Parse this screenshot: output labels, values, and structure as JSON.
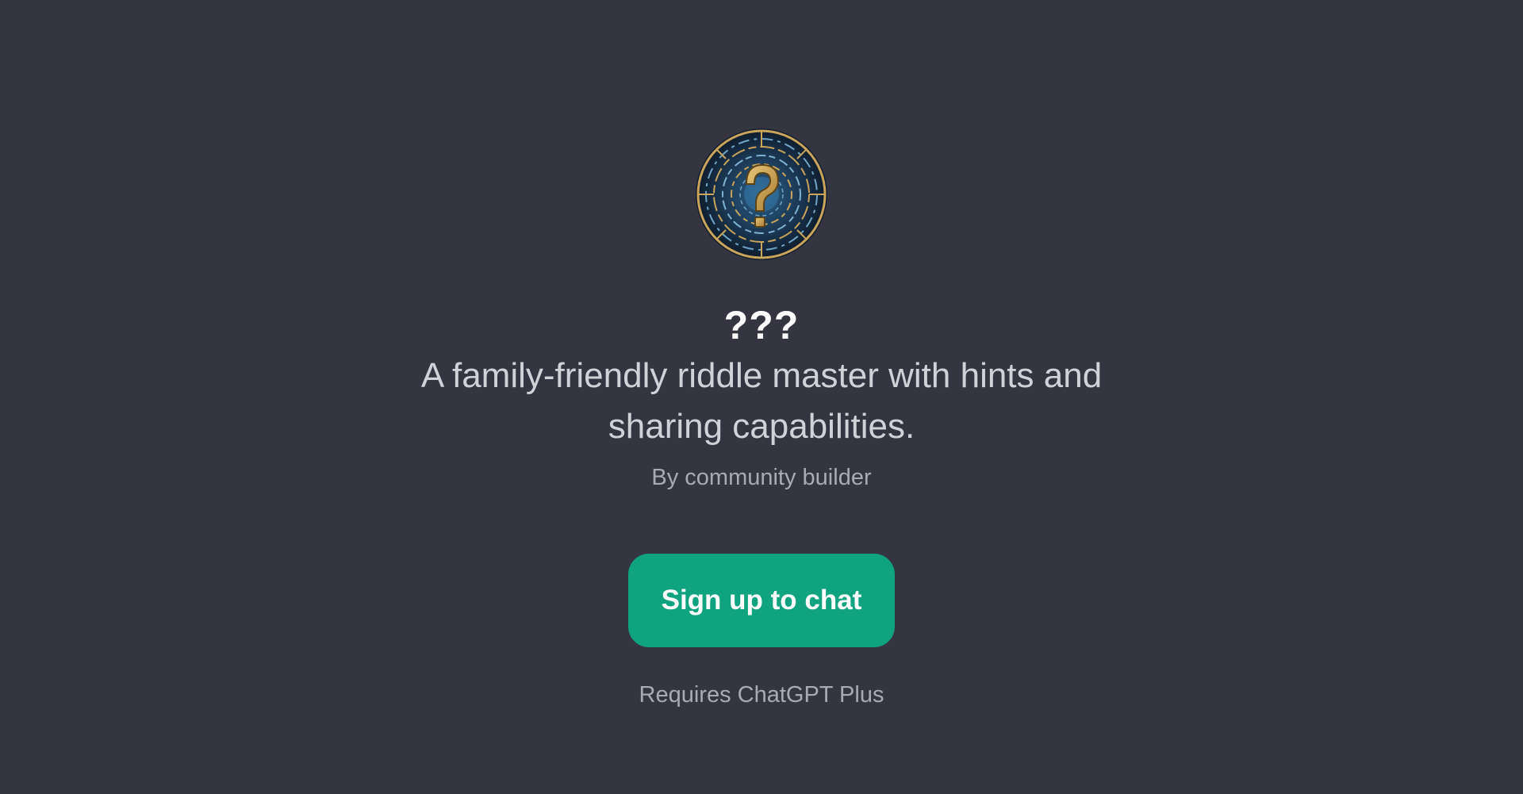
{
  "gpt": {
    "name": "???",
    "description": "A family-friendly riddle master with hints and sharing capabilities.",
    "author": "By community builder",
    "avatar_icon": "maze-question-mark-icon"
  },
  "actions": {
    "signup_label": "Sign up to chat"
  },
  "footer": {
    "requirement": "Requires ChatGPT Plus"
  },
  "colors": {
    "background": "#343541",
    "accent": "#10a37f",
    "title": "#ffffff",
    "description": "#d1d2d8",
    "muted": "#a9aab3"
  }
}
